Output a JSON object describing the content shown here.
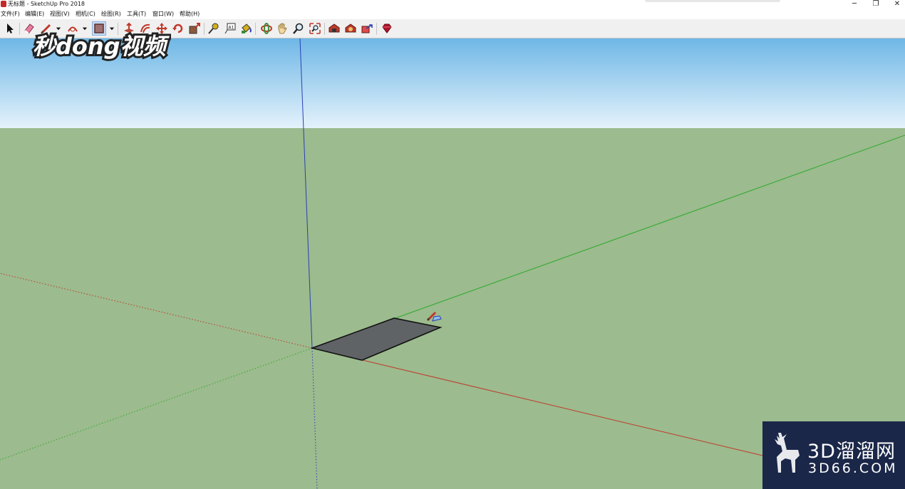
{
  "window": {
    "title": "无标题 - SketchUp Pro 2018",
    "controls": {
      "minimize": "─",
      "restore": "❐",
      "close": "✕"
    }
  },
  "menu": {
    "items": [
      "文件(F)",
      "编辑(E)",
      "视图(V)",
      "相机(C)",
      "绘图(R)",
      "工具(T)",
      "窗口(W)",
      "帮助(H)"
    ]
  },
  "toolbar": {
    "tools": [
      {
        "name": "select-tool",
        "icon": "arrow-icon"
      },
      {
        "name": "eraser-tool",
        "icon": "eraser-icon"
      },
      {
        "name": "line-tool",
        "icon": "pencil-icon"
      },
      {
        "name": "arc-tool",
        "icon": "arc-icon"
      },
      {
        "name": "rectangle-tool",
        "icon": "rectangle-icon",
        "active": true
      },
      {
        "name": "push-pull-tool",
        "icon": "push-pull-icon"
      },
      {
        "name": "offset-tool",
        "icon": "offset-icon"
      },
      {
        "name": "move-tool",
        "icon": "move-icon"
      },
      {
        "name": "rotate-tool",
        "icon": "rotate-icon"
      },
      {
        "name": "scale-tool",
        "icon": "scale-icon"
      },
      {
        "name": "tape-measure-tool",
        "icon": "tape-icon"
      },
      {
        "name": "text-tool",
        "icon": "text-icon"
      },
      {
        "name": "paint-bucket-tool",
        "icon": "paint-bucket-icon"
      },
      {
        "name": "orbit-tool",
        "icon": "orbit-icon"
      },
      {
        "name": "pan-tool",
        "icon": "hand-icon"
      },
      {
        "name": "zoom-tool",
        "icon": "magnifier-icon"
      },
      {
        "name": "zoom-extents-tool",
        "icon": "zoom-extents-icon"
      },
      {
        "name": "warehouse-tool",
        "icon": "warehouse-icon"
      },
      {
        "name": "extension-warehouse-tool",
        "icon": "extension-icon"
      },
      {
        "name": "share-model-tool",
        "icon": "share-icon"
      },
      {
        "name": "extension-manager-tool",
        "icon": "ruby-icon"
      }
    ],
    "text_tool_glyph": "A1"
  },
  "scene": {
    "sky_color": "#a9d6f2",
    "ground_color": "#9cbb8e",
    "axis_colors": {
      "red": "#c0392b",
      "green": "#2eaa2e",
      "blue": "#2a3fb5"
    },
    "face_color": "#5f6366",
    "cursor": "rectangle-cursor-icon"
  },
  "watermarks": {
    "top_left": "秒dong视频",
    "bottom_right_main": "3D溜溜网",
    "bottom_right_sub": "3D66.COM",
    "bottom_right_bg": "#1a2748"
  }
}
